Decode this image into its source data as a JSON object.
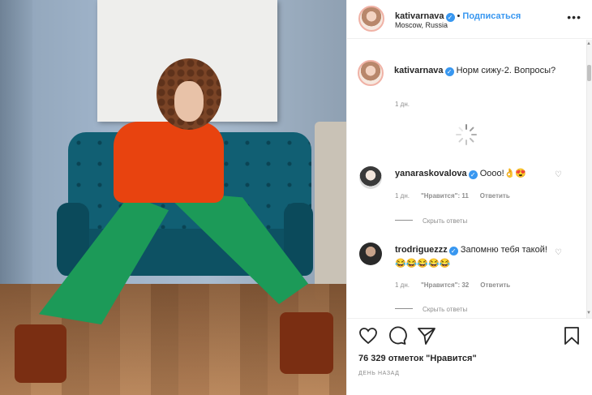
{
  "post": {
    "username": "kativarnava",
    "follow_label": "Подписаться",
    "separator": "•",
    "location": "Moscow, Russia",
    "more_icon": "ellipsis-icon",
    "caption_text": "Норм сижу-2. Вопросы?",
    "caption_time": "1 дн."
  },
  "comments": [
    {
      "username": "yanaraskovalova",
      "text": "Оооо!👌😍",
      "time": "1 дн.",
      "likes": "\"Нравится\": 11",
      "reply": "Ответить",
      "hide_replies": "Скрыть ответы"
    },
    {
      "username": "trodriguezzz",
      "text": "Запомню тебя такой! 😂😂😂😂😂",
      "time": "1 дн.",
      "likes": "\"Нравится\": 32",
      "reply": "Ответить",
      "hide_replies": "Скрыть ответы"
    }
  ],
  "footer": {
    "likes_count": "76 329 отметок \"Нравится\"",
    "date": "ДЕНЬ НАЗАД",
    "icons": [
      "heart-icon",
      "comment-icon",
      "share-icon",
      "bookmark-icon"
    ]
  },
  "colors": {
    "link_blue": "#3897f0",
    "text": "#262626",
    "muted": "#8e8e8e",
    "verified": "#3897f0"
  }
}
